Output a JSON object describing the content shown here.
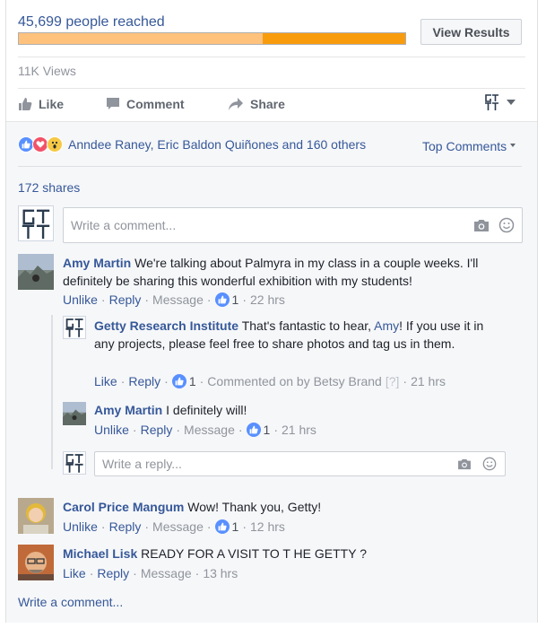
{
  "poll": {
    "reach_label": "45,699 people reached",
    "reach_fraction": 0.37,
    "view_results_label": "View Results"
  },
  "views": "11K Views",
  "actions": {
    "like": "Like",
    "comment": "Comment",
    "share": "Share"
  },
  "reactions": {
    "names": "Anndee Raney, Eric Baldon Quiñones and 160 others",
    "sort_label": "Top Comments"
  },
  "shares": "172 shares",
  "composer": {
    "placeholder": "Write a comment..."
  },
  "comments": [
    {
      "author": "Amy Martin",
      "text": "We're talking about Palmyra in my class in a couple weeks. I'll definitely be sharing this wonderful exhibition with my students!",
      "unlike": "Unlike",
      "reply": "Reply",
      "message": "Message",
      "likes": "1",
      "time": "22 hrs",
      "replies": [
        {
          "author": "Getty Research Institute",
          "text_before": "That's fantastic to hear, ",
          "mention": "Amy",
          "text_after": "! If you use it in any projects, please feel free to share photos and tag us in them.",
          "like": "Like",
          "reply": "Reply",
          "likes": "1",
          "commented_on": "Commented on by Betsy Brand",
          "help": "[?]",
          "time": "21 hrs"
        },
        {
          "author": "Amy Martin",
          "text": "I definitely will!",
          "unlike": "Unlike",
          "reply": "Reply",
          "message": "Message",
          "likes": "1",
          "time": "21 hrs"
        }
      ],
      "reply_placeholder": "Write a reply..."
    },
    {
      "author": "Carol Price Mangum",
      "text": "Wow! Thank you, Getty!",
      "unlike": "Unlike",
      "reply": "Reply",
      "message": "Message",
      "likes": "1",
      "time": "12 hrs"
    },
    {
      "author": "Michael Lisk",
      "text": "READY FOR A VISIT TO T HE GETTY ?",
      "like": "Like",
      "reply": "Reply",
      "message": "Message",
      "time": "13 hrs"
    }
  ],
  "write_comment": "Write a comment...",
  "colors": {
    "link": "#365899",
    "bar_light": "#fec27d",
    "bar_dark": "#f89c0e",
    "like_blue": "#5890ff",
    "love_red": "#f25268",
    "wow_yellow": "#f7c844"
  },
  "icons": [
    "like-thumb-icon",
    "comment-bubble-icon",
    "share-arrow-icon",
    "getty-logo-icon",
    "camera-icon",
    "emoji-icon",
    "like-reaction-icon",
    "love-reaction-icon",
    "wow-reaction-icon",
    "chevron-down-icon"
  ]
}
